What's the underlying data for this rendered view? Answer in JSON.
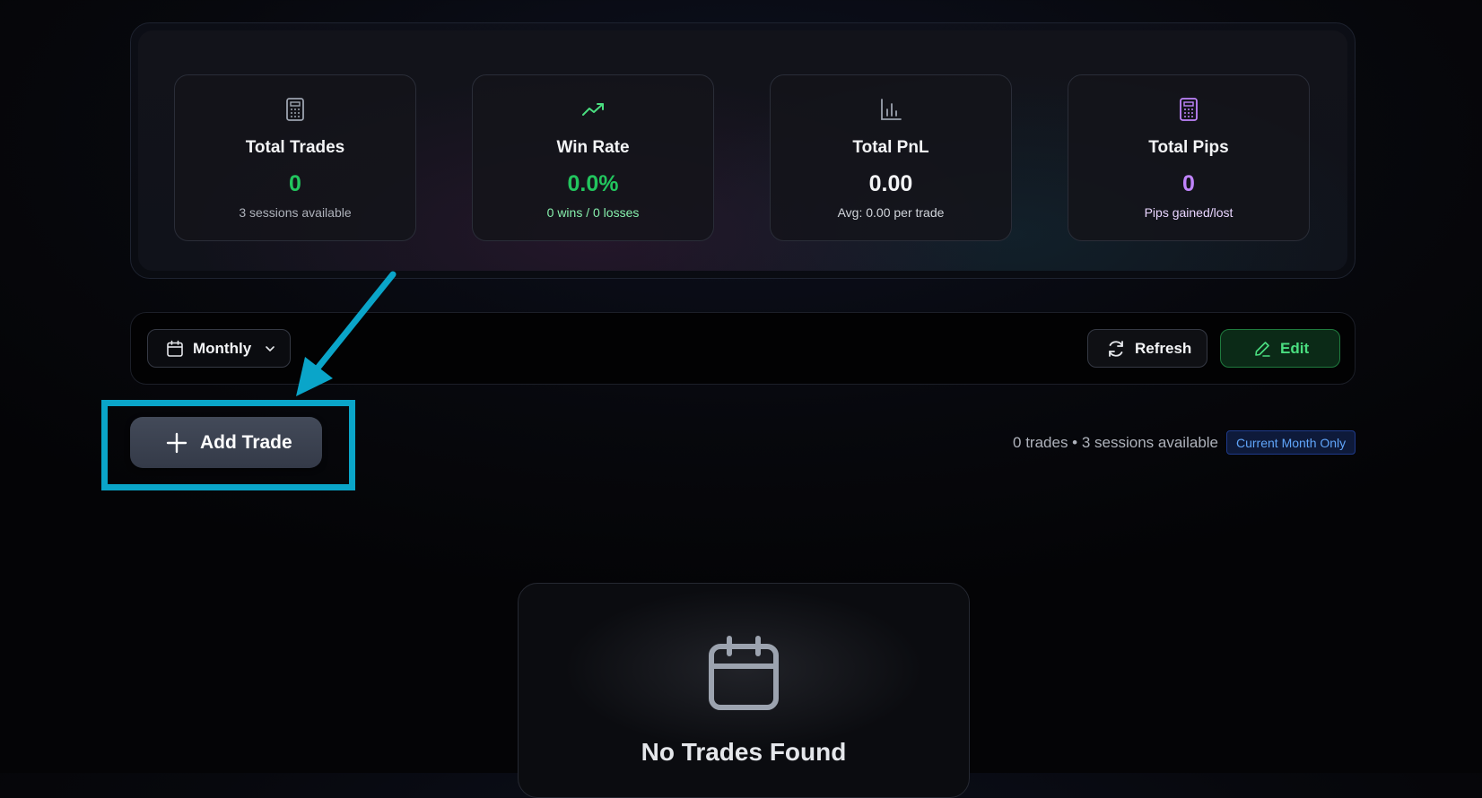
{
  "stats": [
    {
      "icon": "calculator-icon",
      "title": "Total Trades",
      "value": "0",
      "value_color": "#22c55e",
      "subtitle": "3 sessions available",
      "subtitle_color": "#aeb2bb"
    },
    {
      "icon": "trending-up-icon",
      "title": "Win Rate",
      "value": "0.0%",
      "value_color": "#22c55e",
      "subtitle": "0 wins / 0 losses",
      "subtitle_color": "#86efac"
    },
    {
      "icon": "bar-chart-icon",
      "title": "Total PnL",
      "value": "0.00",
      "value_color": "#f3f4f6",
      "subtitle": "Avg: 0.00 per trade",
      "subtitle_color": "#d1d5db"
    },
    {
      "icon": "calculator-icon",
      "title": "Total Pips",
      "value": "0",
      "value_color": "#c084fc",
      "subtitle": "Pips gained/lost",
      "subtitle_color": "#e9d5ff"
    }
  ],
  "toolbar": {
    "period_label": "Monthly",
    "period_icon": "calendar-icon",
    "refresh_label": "Refresh",
    "refresh_icon": "refresh-icon",
    "edit_label": "Edit",
    "edit_icon": "pencil-icon"
  },
  "actions": {
    "add_trade_label": "Add Trade",
    "add_trade_icon": "plus-icon"
  },
  "summary": {
    "text": "0 trades • 3 sessions available",
    "badge": "Current Month Only"
  },
  "empty_state": {
    "icon": "calendar-icon",
    "title": "No Trades Found"
  },
  "annotation": {
    "highlight_color": "#0aa5c9",
    "arrow_color": "#0aa5c9"
  }
}
